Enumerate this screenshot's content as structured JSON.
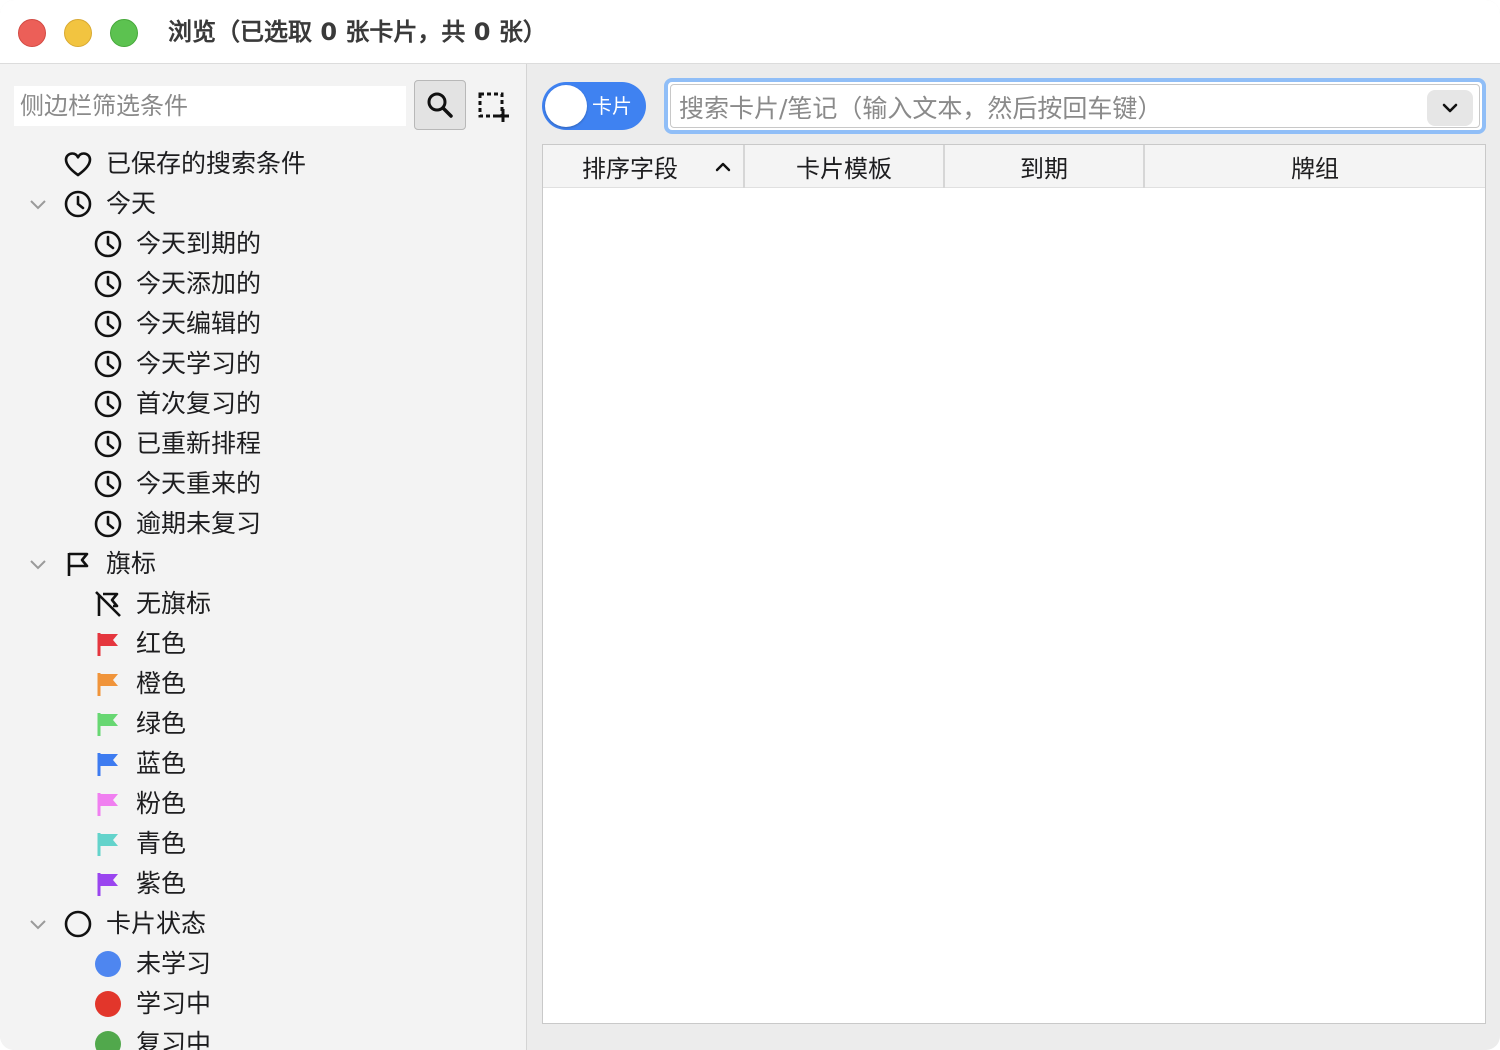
{
  "window": {
    "title": "浏览（已选取 0 张卡片，共 0 张）"
  },
  "sidebar": {
    "filter_placeholder": "侧边栏筛选条件",
    "saved_searches": "已保存的搜索条件",
    "today": {
      "label": "今天",
      "items": [
        "今天到期的",
        "今天添加的",
        "今天编辑的",
        "今天学习的",
        "首次复习的",
        "已重新排程",
        "今天重来的",
        "逾期未复习"
      ]
    },
    "flags": {
      "label": "旗标",
      "no_flag": "无旗标",
      "items": [
        {
          "label": "红色",
          "color": "#e5363e"
        },
        {
          "label": "橙色",
          "color": "#f0943a"
        },
        {
          "label": "绿色",
          "color": "#67d772"
        },
        {
          "label": "蓝色",
          "color": "#3d7bf0"
        },
        {
          "label": "粉色",
          "color": "#f07ff0"
        },
        {
          "label": "青色",
          "color": "#63d3cb"
        },
        {
          "label": "紫色",
          "color": "#9a45ef"
        }
      ]
    },
    "card_state": {
      "label": "卡片状态",
      "items": [
        {
          "label": "未学习",
          "color": "#4e86f0"
        },
        {
          "label": "学习中",
          "color": "#e2362b"
        },
        {
          "label": "复习中",
          "color": "#51a84c"
        }
      ]
    }
  },
  "toolbar": {
    "toggle_label": "卡片",
    "search_placeholder": "搜索卡片/笔记（输入文本，然后按回车键）"
  },
  "table": {
    "columns": [
      "排序字段",
      "卡片模板",
      "到期",
      "牌组"
    ]
  },
  "icons": {
    "search": "search-icon",
    "select": "select-icon",
    "saved": "heart-icon",
    "today": "clock-icon",
    "flag": "flag-icon",
    "no_flag": "no-flag-icon",
    "card_state": "circle-icon",
    "dropdown": "chevron-down-icon",
    "sort": "chevron-up-icon"
  }
}
